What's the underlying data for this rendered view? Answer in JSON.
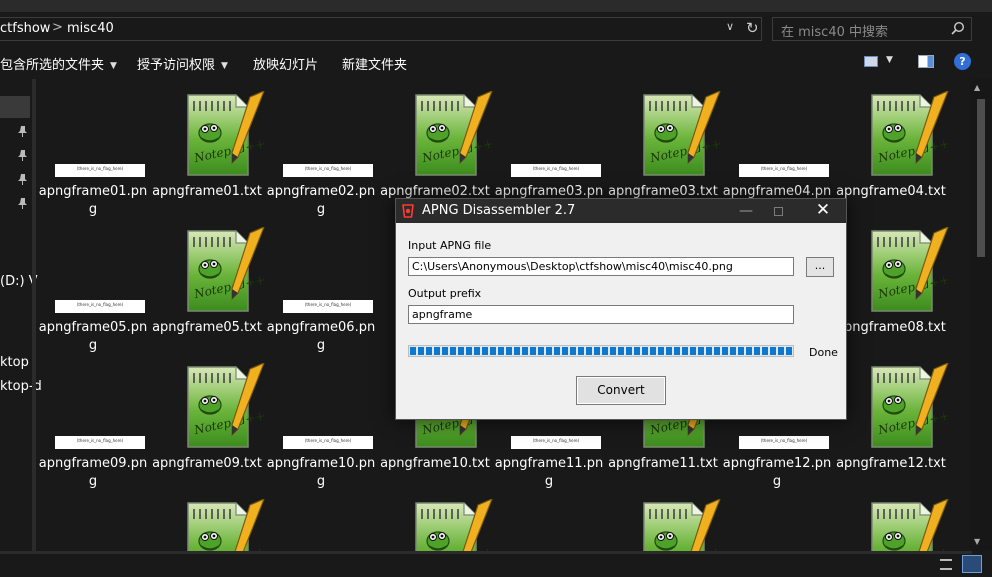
{
  "address": {
    "breadcrumbs": [
      "ctfshow",
      "misc40"
    ],
    "separator": ">",
    "refresh_glyph": "↻",
    "dropdown_glyph": "∨"
  },
  "search": {
    "placeholder": "在 misc40 中搜索"
  },
  "toolbar": {
    "include_in_library": "包含所选的文件夹",
    "grant_access": "授予访问权限",
    "slideshow": "放映幻灯片",
    "new_folder": "新建文件夹",
    "help": "?"
  },
  "nav": {
    "drive": "(D:) V",
    "desktop": "ktop",
    "desktop2": "ktop-d"
  },
  "files": [
    {
      "name": "apngframe01.png",
      "thumb_text": "(there_is_no_flag_here)"
    },
    {
      "name": "apngframe01.txt"
    },
    {
      "name": "apngframe02.png",
      "thumb_text": "(there_is_no_flag_here)"
    },
    {
      "name": "apngframe02.txt"
    },
    {
      "name": "apngframe03.png",
      "thumb_text": "(there_is_no_flag_here)"
    },
    {
      "name": "apngframe03.txt"
    },
    {
      "name": "apngframe04.png",
      "thumb_text": "(there_is_no_flag_here)"
    },
    {
      "name": "apngframe04.txt"
    },
    {
      "name": "apngframe05.png",
      "thumb_text": "(there_is_no_flag_here)"
    },
    {
      "name": "apngframe05.txt"
    },
    {
      "name": "apngframe06.png",
      "thumb_text": "(there_is_no_flag_here)"
    },
    {
      "name": "apngframe08.txt"
    },
    {
      "name": "apngframe09.png",
      "thumb_text": "(there_is_no_flag_here)"
    },
    {
      "name": "apngframe09.txt"
    },
    {
      "name": "apngframe10.png",
      "thumb_text": "(there_is_no_flag_here)"
    },
    {
      "name": "apngframe10.txt"
    },
    {
      "name": "apngframe11.png",
      "thumb_text": "(there_is_no_flag_here)"
    },
    {
      "name": "apngframe11.txt"
    },
    {
      "name": "apngframe12.png",
      "thumb_text": "(there_is_no_flag_here)"
    },
    {
      "name": "apngframe12.txt"
    }
  ],
  "dialog": {
    "title": "APNG Disassembler 2.7",
    "minimize_glyph": "—",
    "close_glyph": "✕",
    "input_label": "Input APNG file",
    "input_value": "C:\\Users\\Anonymous\\Desktop\\ctfshow\\misc40\\misc40.png",
    "browse_label": "...",
    "output_label": "Output prefix",
    "output_value": "apngframe",
    "progress_fraction": 1.0,
    "status": "Done",
    "convert_label": "Convert"
  }
}
